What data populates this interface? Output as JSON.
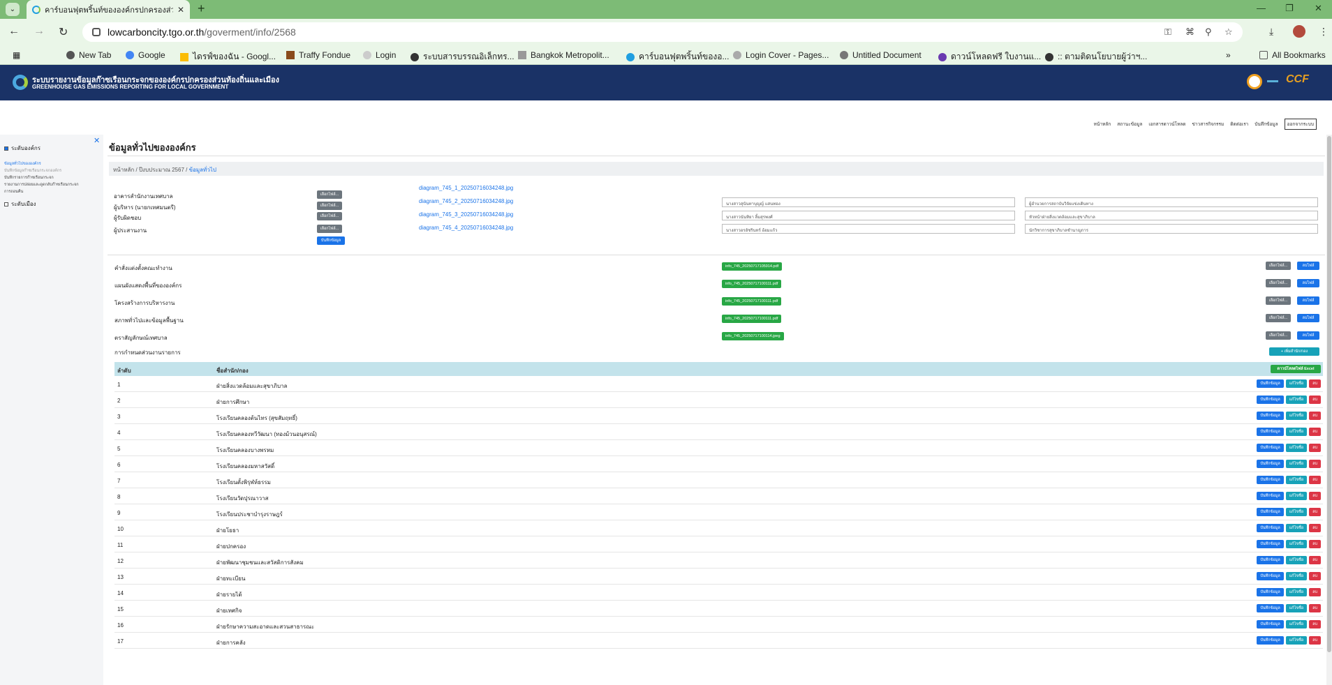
{
  "browser": {
    "tab_title": "คาร์บอนฟุตพริ้นท์ขององค์กรปกครองส่วนท้องถิ่น",
    "url_host": "lowcarboncity.tgo.or.th",
    "url_path": "/goverment/info/2568",
    "bookmarks": [
      "New Tab",
      "Google",
      "ไดรฟ์ของฉัน - Googl...",
      "Traffy Fondue",
      "Login",
      "ระบบสารบรรณอิเล็กทร...",
      "Bangkok Metropolit...",
      "คาร์บอนฟุตพริ้นท์ของอ...",
      "Login Cover - Pages...",
      "Untitled Document",
      "ดาวน์โหลดฟรี ใบงานแ...",
      ":: ตามติดนโยบายผู้ว่าฯ..."
    ],
    "all_bookmarks": "All Bookmarks"
  },
  "site": {
    "title_th": "ระบบรายงานข้อมูลก๊าซเรือนกระจกขององค์กรปกครองส่วนท้องถิ่นและเมือง",
    "title_en": "GREENHOUSE GAS EMISSIONS REPORTING FOR LOCAL GOVERNMENT",
    "logo2_text": "CCF"
  },
  "topnav": [
    "หน้าหลัก",
    "สถานะข้อมูล",
    "เอกสารดาวน์โหลด",
    "ข่าวสารกิจกรรม",
    "ติดต่อเรา",
    "บันทึกข้อมูล",
    "ออกจากระบบ"
  ],
  "sidebar": {
    "section1": "ระดับองค์กร",
    "items": [
      "ข้อมูลทั่วไปขององค์กร",
      "บันทึกข้อมูลก๊าซเรือนกระจกองค์กร",
      "บันทึกรายการก๊าซเรือนกระจก",
      "รายงานการปล่อยและดูดกลับก๊าซเรือนกระจก",
      "การถอนคืน"
    ],
    "section2": "ระดับเมือง"
  },
  "page": {
    "title": "ข้อมูลทั่วไปขององค์กร",
    "breadcrumb": [
      "หน้าหลัก",
      "ปีงบประมาณ 2567",
      "ข้อมูลทั่วไป"
    ]
  },
  "images": {
    "choose_label": "เลือกไฟล์...",
    "save_label": "บันทึกข้อมูล",
    "rows": [
      {
        "label": "อาคารสำนักงานเทศบาล",
        "file": "diagram_745_1_20250716034248.jpg"
      },
      {
        "label": "ผู้บริหาร (นายกเทศมนตรี)",
        "file": "diagram_745_2_20250716034248.jpg",
        "name": "นางสาวสุนันทาบุญญ์ แสนทอง",
        "position": "ผู้อำนวยการสถาบันวิจัยแข่งเดินทาง"
      },
      {
        "label": "ผู้รับผิดชอบ",
        "file": "diagram_745_3_20250716034248.jpg",
        "name": "นางสาวนันทิยา ลิ้มสุรพงศ์",
        "position": "หัวหน้าฝ่ายสิ่งแวดล้อมและสุขาภิบาล"
      },
      {
        "label": "ผู้ประสานงาน",
        "file": "diagram_745_4_20250716034248.jpg",
        "name": "นางสาวอรอัชรินทร์ อ้อมแก้ว",
        "position": "นักวิชาการสุขาภิบาลชำนาญการ"
      }
    ]
  },
  "documents": {
    "choose_label": "เลือกไฟล์...",
    "delete_label": "ลบไฟล์",
    "rows": [
      {
        "label": "คำสั่งแต่งตั้งคณะทำงาน",
        "file": "info_745_20250717105914.pdf"
      },
      {
        "label": "แผนผังแสดงพื้นที่ขององค์กร",
        "file": "info_745_20250717100111.pdf"
      },
      {
        "label": "โครงสร้างการบริหารงาน",
        "file": "info_745_20250717100111.pdf"
      },
      {
        "label": "สภาพทั่วไปและข้อมูลพื้นฐาน",
        "file": "info_745_20250717100111.pdf"
      },
      {
        "label": "ตราสัญลักษณ์เทศบาล",
        "file": "info_745_20250717100114.jpeg"
      }
    ]
  },
  "reporting": {
    "label": "การกำหนดส่วนงานรายการ",
    "add_label": "+ เพิ่มสำนัก/กอง",
    "export_label": "ดาวน์โหลดไฟล์ Excel",
    "col_no": "ลำดับ",
    "col_name": "ชื่อสำนัก/กอง",
    "btn_save": "บันทึกข้อมูล",
    "btn_edit": "แก้ไขชื่อ",
    "btn_delete": "ลบ",
    "rows": [
      {
        "no": "1",
        "name": "ฝ่ายสิ่งแวดล้อมและสุขาภิบาล"
      },
      {
        "no": "2",
        "name": "ฝ่ายการศึกษา"
      },
      {
        "no": "3",
        "name": "โรงเรียนคลองต้นไทร (สุขสัมฤทธิ์)"
      },
      {
        "no": "4",
        "name": "โรงเรียนคลองทวีวัฒนา (ทองม้วนอนุสรณ์)"
      },
      {
        "no": "5",
        "name": "โรงเรียนคลองบางพรหม"
      },
      {
        "no": "6",
        "name": "โรงเรียนคลองมหาสวัสดิ์"
      },
      {
        "no": "7",
        "name": "โรงเรียนตั้งพิรุฬห์ธรรม"
      },
      {
        "no": "8",
        "name": "โรงเรียนวัดปุรณาวาส"
      },
      {
        "no": "9",
        "name": "โรงเรียนประชาบำรุงราษฎร์"
      },
      {
        "no": "10",
        "name": "ฝ่ายโยธา"
      },
      {
        "no": "11",
        "name": "ฝ่ายปกครอง"
      },
      {
        "no": "12",
        "name": "ฝ่ายพัฒนาชุมชนและสวัสดิการสังคม"
      },
      {
        "no": "13",
        "name": "ฝ่ายทะเบียน"
      },
      {
        "no": "14",
        "name": "ฝ่ายรายได้"
      },
      {
        "no": "15",
        "name": "ฝ่ายเทศกิจ"
      },
      {
        "no": "16",
        "name": "ฝ่ายรักษาความสะอาดและสวนสาธารณะ"
      },
      {
        "no": "17",
        "name": "ฝ่ายการคลัง"
      }
    ]
  },
  "colors": {
    "header": "#1a3266",
    "accent": "#1a73e8",
    "browser": "#7dbb76"
  }
}
